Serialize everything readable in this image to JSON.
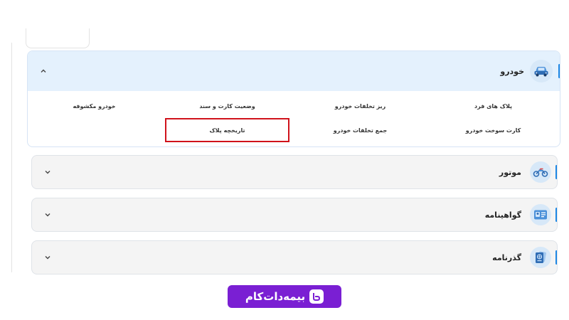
{
  "sections": [
    {
      "title": "خودرو",
      "icon": "car-icon",
      "expanded": true,
      "items": [
        "پلاک های فرد",
        "ریز تخلفات خودرو",
        "وضعیت کارت و سند",
        "خودرو مکشوفه",
        "کارت سوخت خودرو",
        "جمع تخلفات خودرو",
        "تاریخچه پلاک"
      ]
    },
    {
      "title": "موتور",
      "icon": "motorcycle-icon",
      "expanded": false
    },
    {
      "title": "گواهینامه",
      "icon": "license-card-icon",
      "expanded": false
    },
    {
      "title": "گذرنامه",
      "icon": "passport-icon",
      "expanded": false
    }
  ],
  "highlighted_item": "تاریخچه پلاک",
  "brand": {
    "name": "بیمه‌دات‌کام",
    "color": "#7a1fd3"
  },
  "colors": {
    "accent": "#1e88e5",
    "highlight_border": "#d0121b",
    "open_header_bg": "#e4f1fd"
  }
}
